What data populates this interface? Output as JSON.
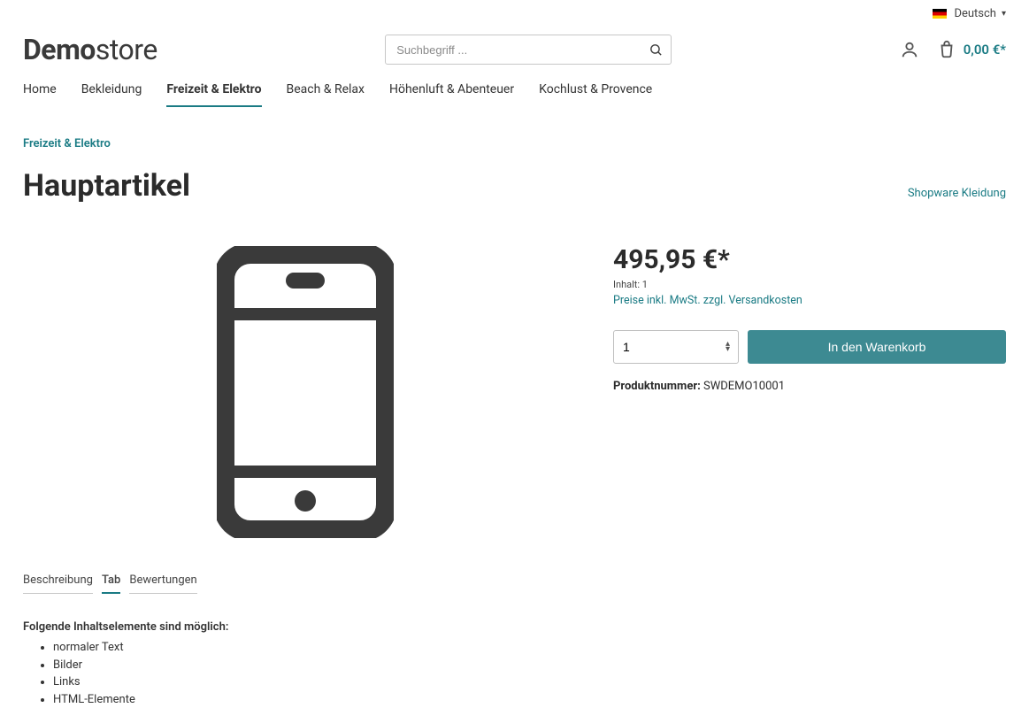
{
  "topbar": {
    "language": "Deutsch"
  },
  "logo": {
    "bold": "Demo",
    "light": "store"
  },
  "search": {
    "placeholder": "Suchbegriff ..."
  },
  "cart": {
    "total": "0,00 €*"
  },
  "nav": {
    "items": [
      {
        "label": "Home",
        "active": false
      },
      {
        "label": "Bekleidung",
        "active": false
      },
      {
        "label": "Freizeit & Elektro",
        "active": true
      },
      {
        "label": "Beach & Relax",
        "active": false
      },
      {
        "label": "Höhenluft & Abenteuer",
        "active": false
      },
      {
        "label": "Kochlust & Provence",
        "active": false
      }
    ]
  },
  "breadcrumb": {
    "label": "Freizeit & Elektro"
  },
  "title": "Hauptartikel",
  "brand": "Shopware Kleidung",
  "product": {
    "price": "495,95 €*",
    "content_label": "Inhalt:",
    "content_value": "1",
    "tax_info": "Preise inkl. MwSt. zzgl. Versandkosten",
    "qty_selected": "1",
    "add_to_cart": "In den Warenkorb",
    "sku_label": "Produktnummer:",
    "sku_value": "SWDEMO10001"
  },
  "tabs": {
    "items": [
      {
        "label": "Beschreibung",
        "active": false
      },
      {
        "label": "Tab",
        "active": true
      },
      {
        "label": "Bewertungen",
        "active": false
      }
    ],
    "content": {
      "intro": "Folgende Inhaltselemente sind möglich:",
      "bullets": [
        "normaler Text",
        "Bilder",
        "Links",
        "HTML-Elemente"
      ]
    }
  }
}
